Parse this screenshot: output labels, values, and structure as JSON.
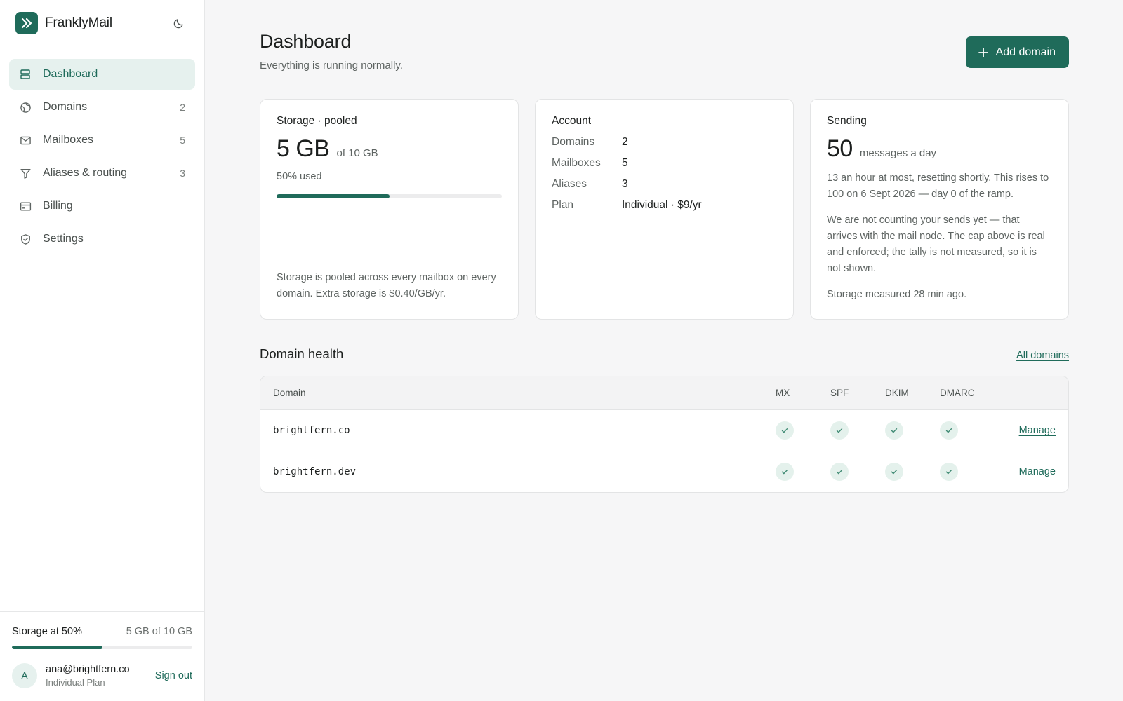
{
  "app": {
    "name": "FranklyMail"
  },
  "sidebar": {
    "items": [
      {
        "label": "Dashboard",
        "icon": "dashboard-icon",
        "count": ""
      },
      {
        "label": "Domains",
        "icon": "globe-icon",
        "count": "2"
      },
      {
        "label": "Mailboxes",
        "icon": "mail-icon",
        "count": "5"
      },
      {
        "label": "Aliases & routing",
        "icon": "filter-icon",
        "count": "3"
      },
      {
        "label": "Billing",
        "icon": "card-icon",
        "count": ""
      },
      {
        "label": "Settings",
        "icon": "shield-icon",
        "count": ""
      }
    ],
    "storage": {
      "label": "Storage at 50%",
      "value": "5 GB of 10 GB",
      "fraction": 0.5
    },
    "user": {
      "initial": "A",
      "email": "ana@brightfern.co",
      "plan": "Individual Plan",
      "signout": "Sign out"
    }
  },
  "header": {
    "title": "Dashboard",
    "subtitle": "Everything is running normally.",
    "add_label": "Add domain"
  },
  "cards": {
    "storage": {
      "title": "Storage · pooled",
      "amount": "5 GB",
      "of": "of 10 GB",
      "used": "50% used",
      "fraction": 0.5,
      "note": "Storage is pooled across every mailbox on every domain. Extra storage is $0.40/GB/yr."
    },
    "account": {
      "title": "Account",
      "rows": [
        {
          "k": "Domains",
          "v": "2"
        },
        {
          "k": "Mailboxes",
          "v": "5"
        },
        {
          "k": "Aliases",
          "v": "3"
        },
        {
          "k": "Plan",
          "v": "Individual · $9/yr"
        }
      ]
    },
    "sending": {
      "title": "Sending",
      "amount": "50",
      "unit": "messages a day",
      "p1": "13 an hour at most, resetting shortly. This rises to 100 on 6 Sept 2026 — day 0 of the ramp.",
      "p2": "We are not counting your sends yet — that arrives with the mail node. The cap above is real and enforced; the tally is not measured, so it is not shown.",
      "p3": "Storage measured 28 min ago."
    }
  },
  "domain_health": {
    "title": "Domain health",
    "all_link": "All domains",
    "columns": {
      "domain": "Domain",
      "mx": "MX",
      "spf": "SPF",
      "dkim": "DKIM",
      "dmarc": "DMARC"
    },
    "rows": [
      {
        "domain": "brightfern.co",
        "manage": "Manage"
      },
      {
        "domain": "brightfern.dev",
        "manage": "Manage"
      }
    ]
  },
  "colors": {
    "accent": "#1f6b5a",
    "accent_soft": "#e6f1ee"
  }
}
